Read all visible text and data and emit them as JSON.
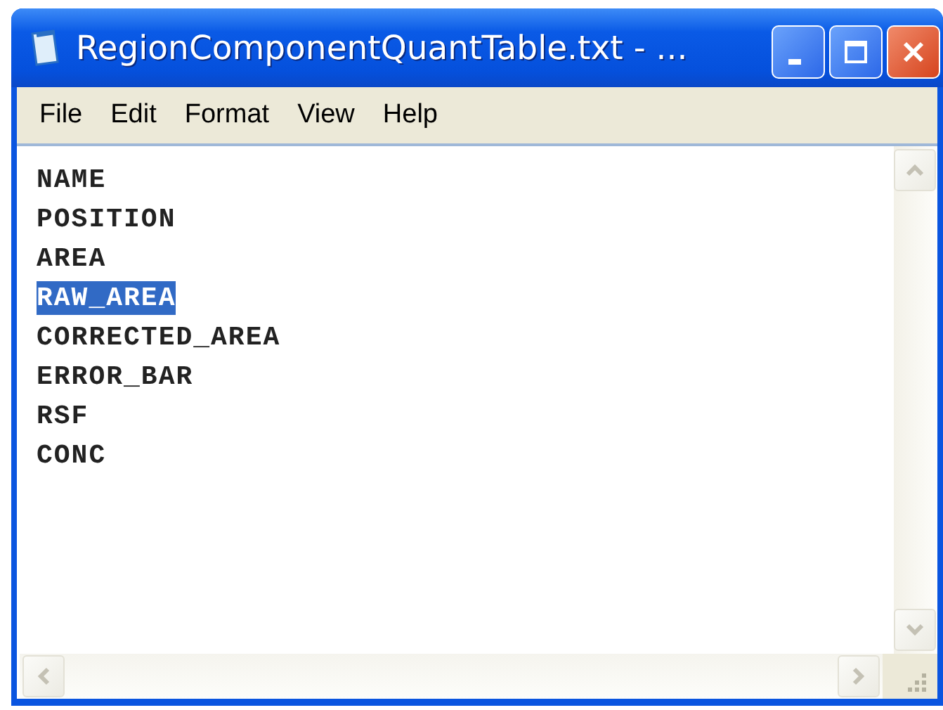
{
  "window": {
    "title": "RegionComponentQuantTable.txt - ..."
  },
  "menu": [
    {
      "label": "File"
    },
    {
      "label": "Edit"
    },
    {
      "label": "Format"
    },
    {
      "label": "View"
    },
    {
      "label": "Help"
    }
  ],
  "lines": [
    {
      "text": "NAME",
      "selected": false
    },
    {
      "text": "POSITION",
      "selected": false
    },
    {
      "text": "AREA",
      "selected": false
    },
    {
      "text": "RAW_AREA",
      "selected": true
    },
    {
      "text": "CORRECTED_AREA",
      "selected": false
    },
    {
      "text": "ERROR_BAR",
      "selected": false
    },
    {
      "text": "RSF",
      "selected": false
    },
    {
      "text": "CONC",
      "selected": false
    }
  ]
}
